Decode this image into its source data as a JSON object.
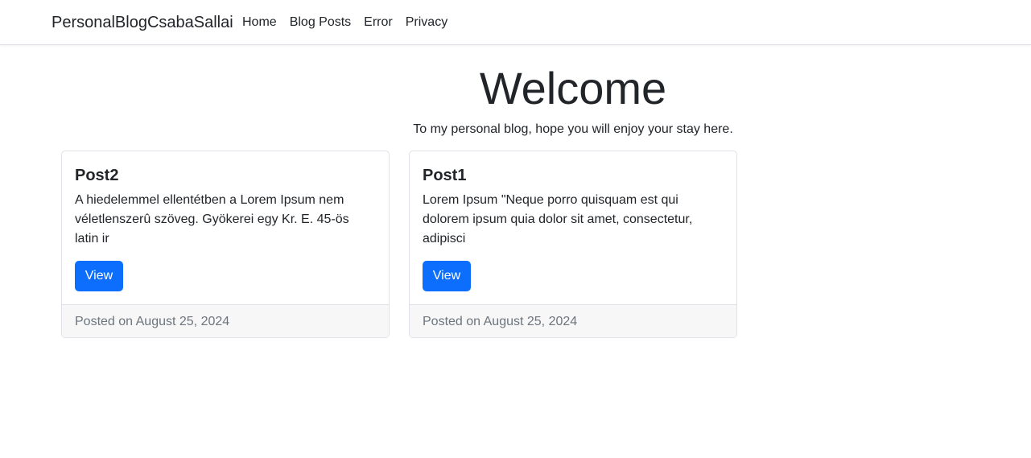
{
  "navbar": {
    "brand": "PersonalBlogCsabaSallai",
    "links": [
      "Home",
      "Blog Posts",
      "Error",
      "Privacy"
    ]
  },
  "hero": {
    "title": "Welcome",
    "subtitle": "To my personal blog, hope you will enjoy your stay here."
  },
  "posts": [
    {
      "title": "Post2",
      "excerpt": "A hiedelemmel ellentétben a Lorem Ipsum nem véletlenszerû szöveg. Gyökerei egy Kr. E. 45-ös latin ir",
      "button": "View",
      "footer": "Posted on August 25, 2024"
    },
    {
      "title": "Post1",
      "excerpt": "Lorem Ipsum \"Neque porro quisquam est qui dolorem ipsum quia dolor sit amet, consectetur, adipisci",
      "button": "View",
      "footer": "Posted on August 25, 2024"
    }
  ],
  "colors": {
    "primary": "#0d6efd",
    "muted_text": "#6c757d",
    "footer_bg": "#f7f7f7"
  }
}
